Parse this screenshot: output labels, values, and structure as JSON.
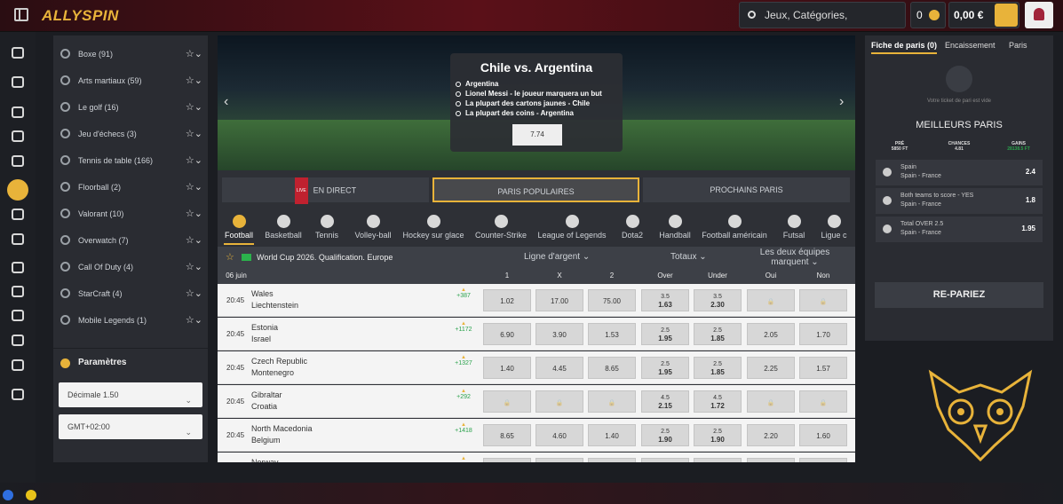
{
  "header": {
    "brand": "ALLYSPIN",
    "search_placeholder": "Jeux, Catégories, Fournisseurs",
    "coins": "0",
    "balance": "0,00 €"
  },
  "rail": [
    "gift-icon",
    "home-icon",
    "betslip-icon",
    "cards-icon",
    "clover-icon",
    "sports-ball-icon",
    "live-icon",
    "tv-icon",
    "soccer-icon",
    "medal-icon",
    "trophy-icon",
    "rocket-icon",
    "cart-icon",
    "diamond-icon"
  ],
  "sidebar": {
    "sports": [
      {
        "label": "Boxe (91)"
      },
      {
        "label": "Arts martiaux (59)"
      },
      {
        "label": "Le golf (16)"
      },
      {
        "label": "Jeu d'échecs (3)"
      },
      {
        "label": "Tennis de table (166)"
      },
      {
        "label": "Floorball (2)"
      },
      {
        "label": "Valorant (10)"
      },
      {
        "label": "Overwatch (7)"
      },
      {
        "label": "Call Of Duty (4)"
      },
      {
        "label": "StarCraft (4)"
      },
      {
        "label": "Mobile Legends (1)"
      }
    ],
    "params_title": "Paramètres",
    "odds_format": "Décimale 1.50",
    "timezone": "GMT+02:00"
  },
  "banner": {
    "title": "Chile vs. Argentina",
    "selections": [
      "Argentina",
      "Lionel Messi - le joueur marquera un but",
      "La plupart des cartons jaunes - Chile",
      "La plupart des coins - Argentina"
    ],
    "odds": "7.74"
  },
  "tabs": [
    "EN DIRECT",
    "PARIS POPULAIRES",
    "PROCHAINS PARIS"
  ],
  "live_badge": "LIVE",
  "sports_bar": [
    "Football",
    "Basketball",
    "Tennis",
    "Volley-ball",
    "Hockey sur glace",
    "Counter-Strike",
    "League of Legends",
    "Dota2",
    "Handball",
    "Football américain",
    "Futsal",
    "Ligue c"
  ],
  "league": {
    "name": "World Cup 2026. Qualification. Europe",
    "markets": [
      "Ligne d'argent",
      "Totaux",
      "Les deux équipes marquent"
    ]
  },
  "table": {
    "date": "06 juin",
    "headers": [
      "1",
      "X",
      "2",
      "Over",
      "Under",
      "Oui",
      "Non"
    ],
    "rows": [
      {
        "time": "20:45",
        "home": "Wales",
        "away": "Liechtenstein",
        "more": "+387",
        "o1": "1.02",
        "ox": "17.00",
        "o2": "75.00",
        "ov_l": "3.5",
        "ov": "1.63",
        "un_l": "3.5",
        "un": "2.30",
        "yes": "",
        "no": ""
      },
      {
        "time": "20:45",
        "home": "Estonia",
        "away": "Israel",
        "more": "+1172",
        "o1": "6.90",
        "ox": "3.90",
        "o2": "1.53",
        "ov_l": "2.5",
        "ov": "1.95",
        "un_l": "2.5",
        "un": "1.85",
        "yes": "2.05",
        "no": "1.70"
      },
      {
        "time": "20:45",
        "home": "Czech Republic",
        "away": "Montenegro",
        "more": "+1327",
        "o1": "1.40",
        "ox": "4.45",
        "o2": "8.65",
        "ov_l": "2.5",
        "ov": "1.95",
        "un_l": "2.5",
        "un": "1.85",
        "yes": "2.25",
        "no": "1.57"
      },
      {
        "time": "20:45",
        "home": "Gibraltar",
        "away": "Croatia",
        "more": "+292",
        "o1": "",
        "ox": "",
        "o2": "",
        "ov_l": "4.5",
        "ov": "2.15",
        "un_l": "4.5",
        "un": "1.72",
        "yes": "",
        "no": ""
      },
      {
        "time": "20:45",
        "home": "North Macedonia",
        "away": "Belgium",
        "more": "+1418",
        "o1": "8.65",
        "ox": "4.60",
        "o2": "1.40",
        "ov_l": "2.5",
        "ov": "1.90",
        "un_l": "2.5",
        "un": "1.90",
        "yes": "2.20",
        "no": "1.60"
      },
      {
        "time": "",
        "home": "Norway",
        "away": "",
        "more": "",
        "o1": "",
        "ox": "",
        "o2": "",
        "ov_l": "",
        "ov": "",
        "un_l": "",
        "un": "",
        "yes": "",
        "no": ""
      }
    ]
  },
  "betslip": {
    "tabs": [
      "Fiche de paris (0)",
      "Encaissement",
      "Paris"
    ],
    "empty": "Votre ticket de pari est vide",
    "best_title": "MEILLEURS PARIS",
    "stats": [
      {
        "label": "PRÉ",
        "value": "5850 FT"
      },
      {
        "label": "CHANCES",
        "value": "4.81"
      },
      {
        "label": "GAINS",
        "value": "28138.5 FT"
      }
    ],
    "picks": [
      {
        "title": "Spain",
        "match": "Spain - France",
        "odd": "2.4"
      },
      {
        "title": "Both teams to score - YES",
        "match": "Spain - France",
        "odd": "1.8"
      },
      {
        "title": "Total OVER 2.5",
        "match": "Spain - France",
        "odd": "1.95"
      }
    ],
    "repariez": "RE-PARIEZ"
  },
  "colors": {
    "accent": "#e8b33a",
    "header": "#5a1018"
  }
}
